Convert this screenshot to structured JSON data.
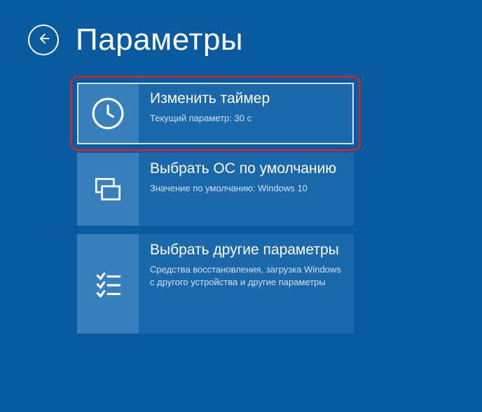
{
  "header": {
    "title": "Параметры"
  },
  "options": [
    {
      "title": "Изменить таймер",
      "desc": "Текущий параметр: 30 с",
      "icon": "clock",
      "highlighted": true
    },
    {
      "title": "Выбрать ОС по умолчанию",
      "desc": "Значение по умолчанию: Windows 10",
      "icon": "windows",
      "highlighted": false
    },
    {
      "title": "Выбрать другие параметры",
      "desc": "Средства восстановления, загрузка Windows с другого устройства и другие параметры",
      "icon": "checklist",
      "highlighted": false
    }
  ]
}
